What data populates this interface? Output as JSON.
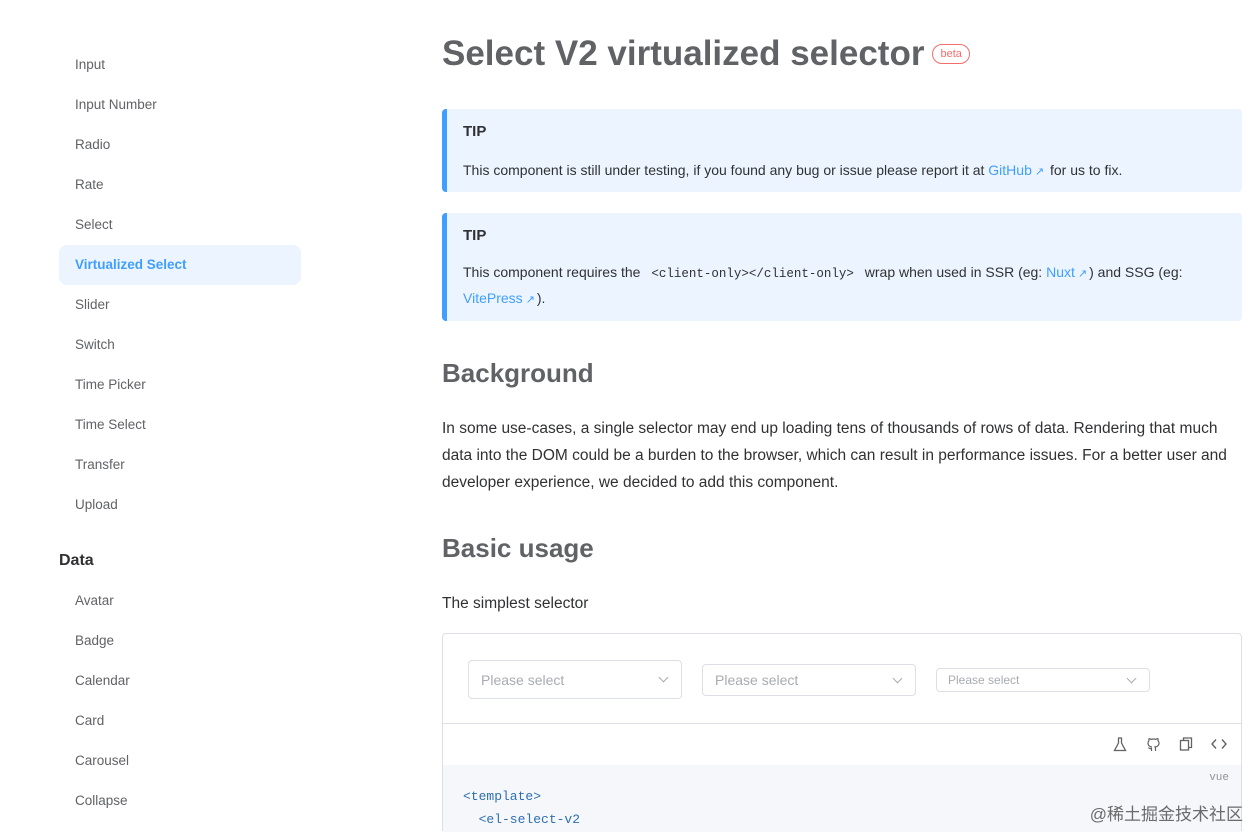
{
  "sidebar": {
    "items_top": [
      "Input",
      "Input Number",
      "Radio",
      "Rate",
      "Select",
      "Virtualized Select",
      "Slider",
      "Switch",
      "Time Picker",
      "Time Select",
      "Transfer",
      "Upload"
    ],
    "active": "Virtualized Select",
    "group_title": "Data",
    "items_data": [
      "Avatar",
      "Badge",
      "Calendar",
      "Card",
      "Carousel",
      "Collapse"
    ]
  },
  "header": {
    "title": "Select V2 virtualized selector",
    "badge": "beta"
  },
  "tips": [
    {
      "title": "TIP",
      "text_before": "This component is still under testing, if you found any bug or issue please report it at ",
      "link": "GitHub",
      "text_after": " for us to fix."
    },
    {
      "title": "TIP",
      "text_before": "This component requires the ",
      "code": "<client-only></client-only>",
      "text_mid": " wrap when used in SSR (eg: ",
      "link1": "Nuxt",
      "text_mid2": ") and SSG (eg: ",
      "link2": "VitePress",
      "text_after": ")."
    }
  ],
  "background": {
    "heading": "Background",
    "text": "In some use-cases, a single selector may end up loading tens of thousands of rows of data. Rendering that much data into the DOM could be a burden to the browser, which can result in performance issues. For a better user and developer experience, we decided to add this component."
  },
  "basic_usage": {
    "heading": "Basic usage",
    "description": "The simplest selector",
    "selects": [
      {
        "placeholder": "Please select",
        "size": "large"
      },
      {
        "placeholder": "Please select",
        "size": "default"
      },
      {
        "placeholder": "Please select",
        "size": "small"
      }
    ],
    "toolbar_icons": [
      "flask-icon",
      "github-icon",
      "copy-icon",
      "code-icon"
    ],
    "code_lang": "vue",
    "code_lines": [
      "<template>",
      "  <el-select-v2"
    ]
  },
  "watermark": "@稀土掘金技术社区"
}
